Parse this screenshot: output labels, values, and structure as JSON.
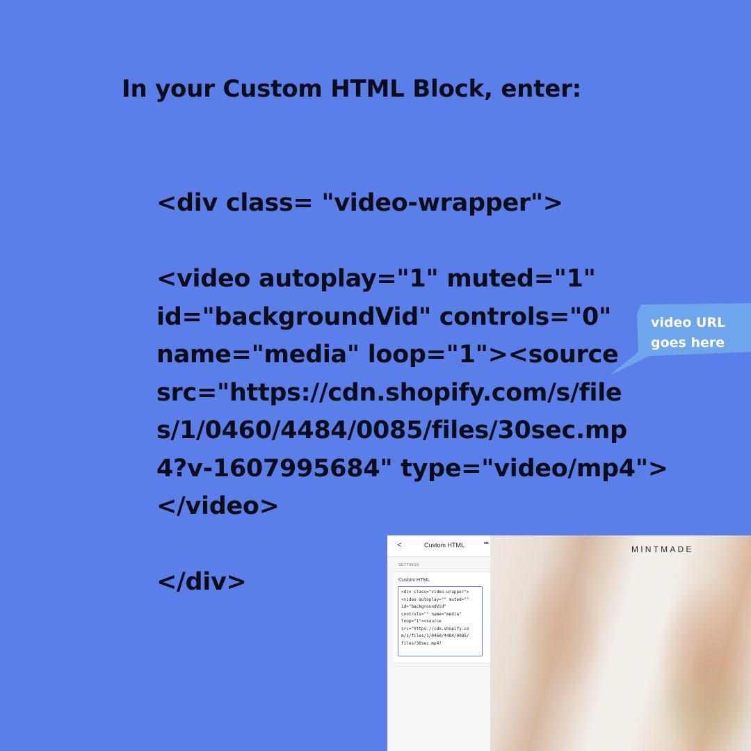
{
  "heading": "In your Custom HTML Block, enter:",
  "code_lines": [
    "<div class= \"video-wrapper\">",
    "",
    "<video autoplay=\"1\" muted=\"1\"",
    "id=\"backgroundVid\" controls=\"0\"",
    "name=\"media\" loop=\"1\"><source",
    "src=\"https://cdn.shopify.com/s/file",
    "s/1/0460/4484/0085/files/30sec.mp",
    "4?v-1607995684\" type=\"video/mp4\">",
    "</video>",
    "",
    "</div>"
  ],
  "callout": {
    "line1": "video URL",
    "line2": "goes here",
    "color": "#6ea6ec"
  },
  "screenshot": {
    "panel_title": "Custom HTML",
    "back_icon": "chevron-left-icon",
    "more_icon": "more-dots-icon",
    "section_label": "SETTINGS",
    "field_label": "Custom HTML",
    "field_value": "<div class=\"video-wrapper\">\n<video autoplay=\"\" muted=\"\"\nid=\"backgroundVid\"\ncontrols=\"\" name=\"media\"\nloop=\"1\"><source\nsrc=\"https://cdn.shopify.co\nm/s/files/1/0460/4484/0085/\nfiles/30sec.mp4?",
    "brand": "MINTMADE"
  },
  "colors": {
    "background": "#5b7fe9",
    "text": "#0b0d1a",
    "field_border": "#5a84e6"
  }
}
